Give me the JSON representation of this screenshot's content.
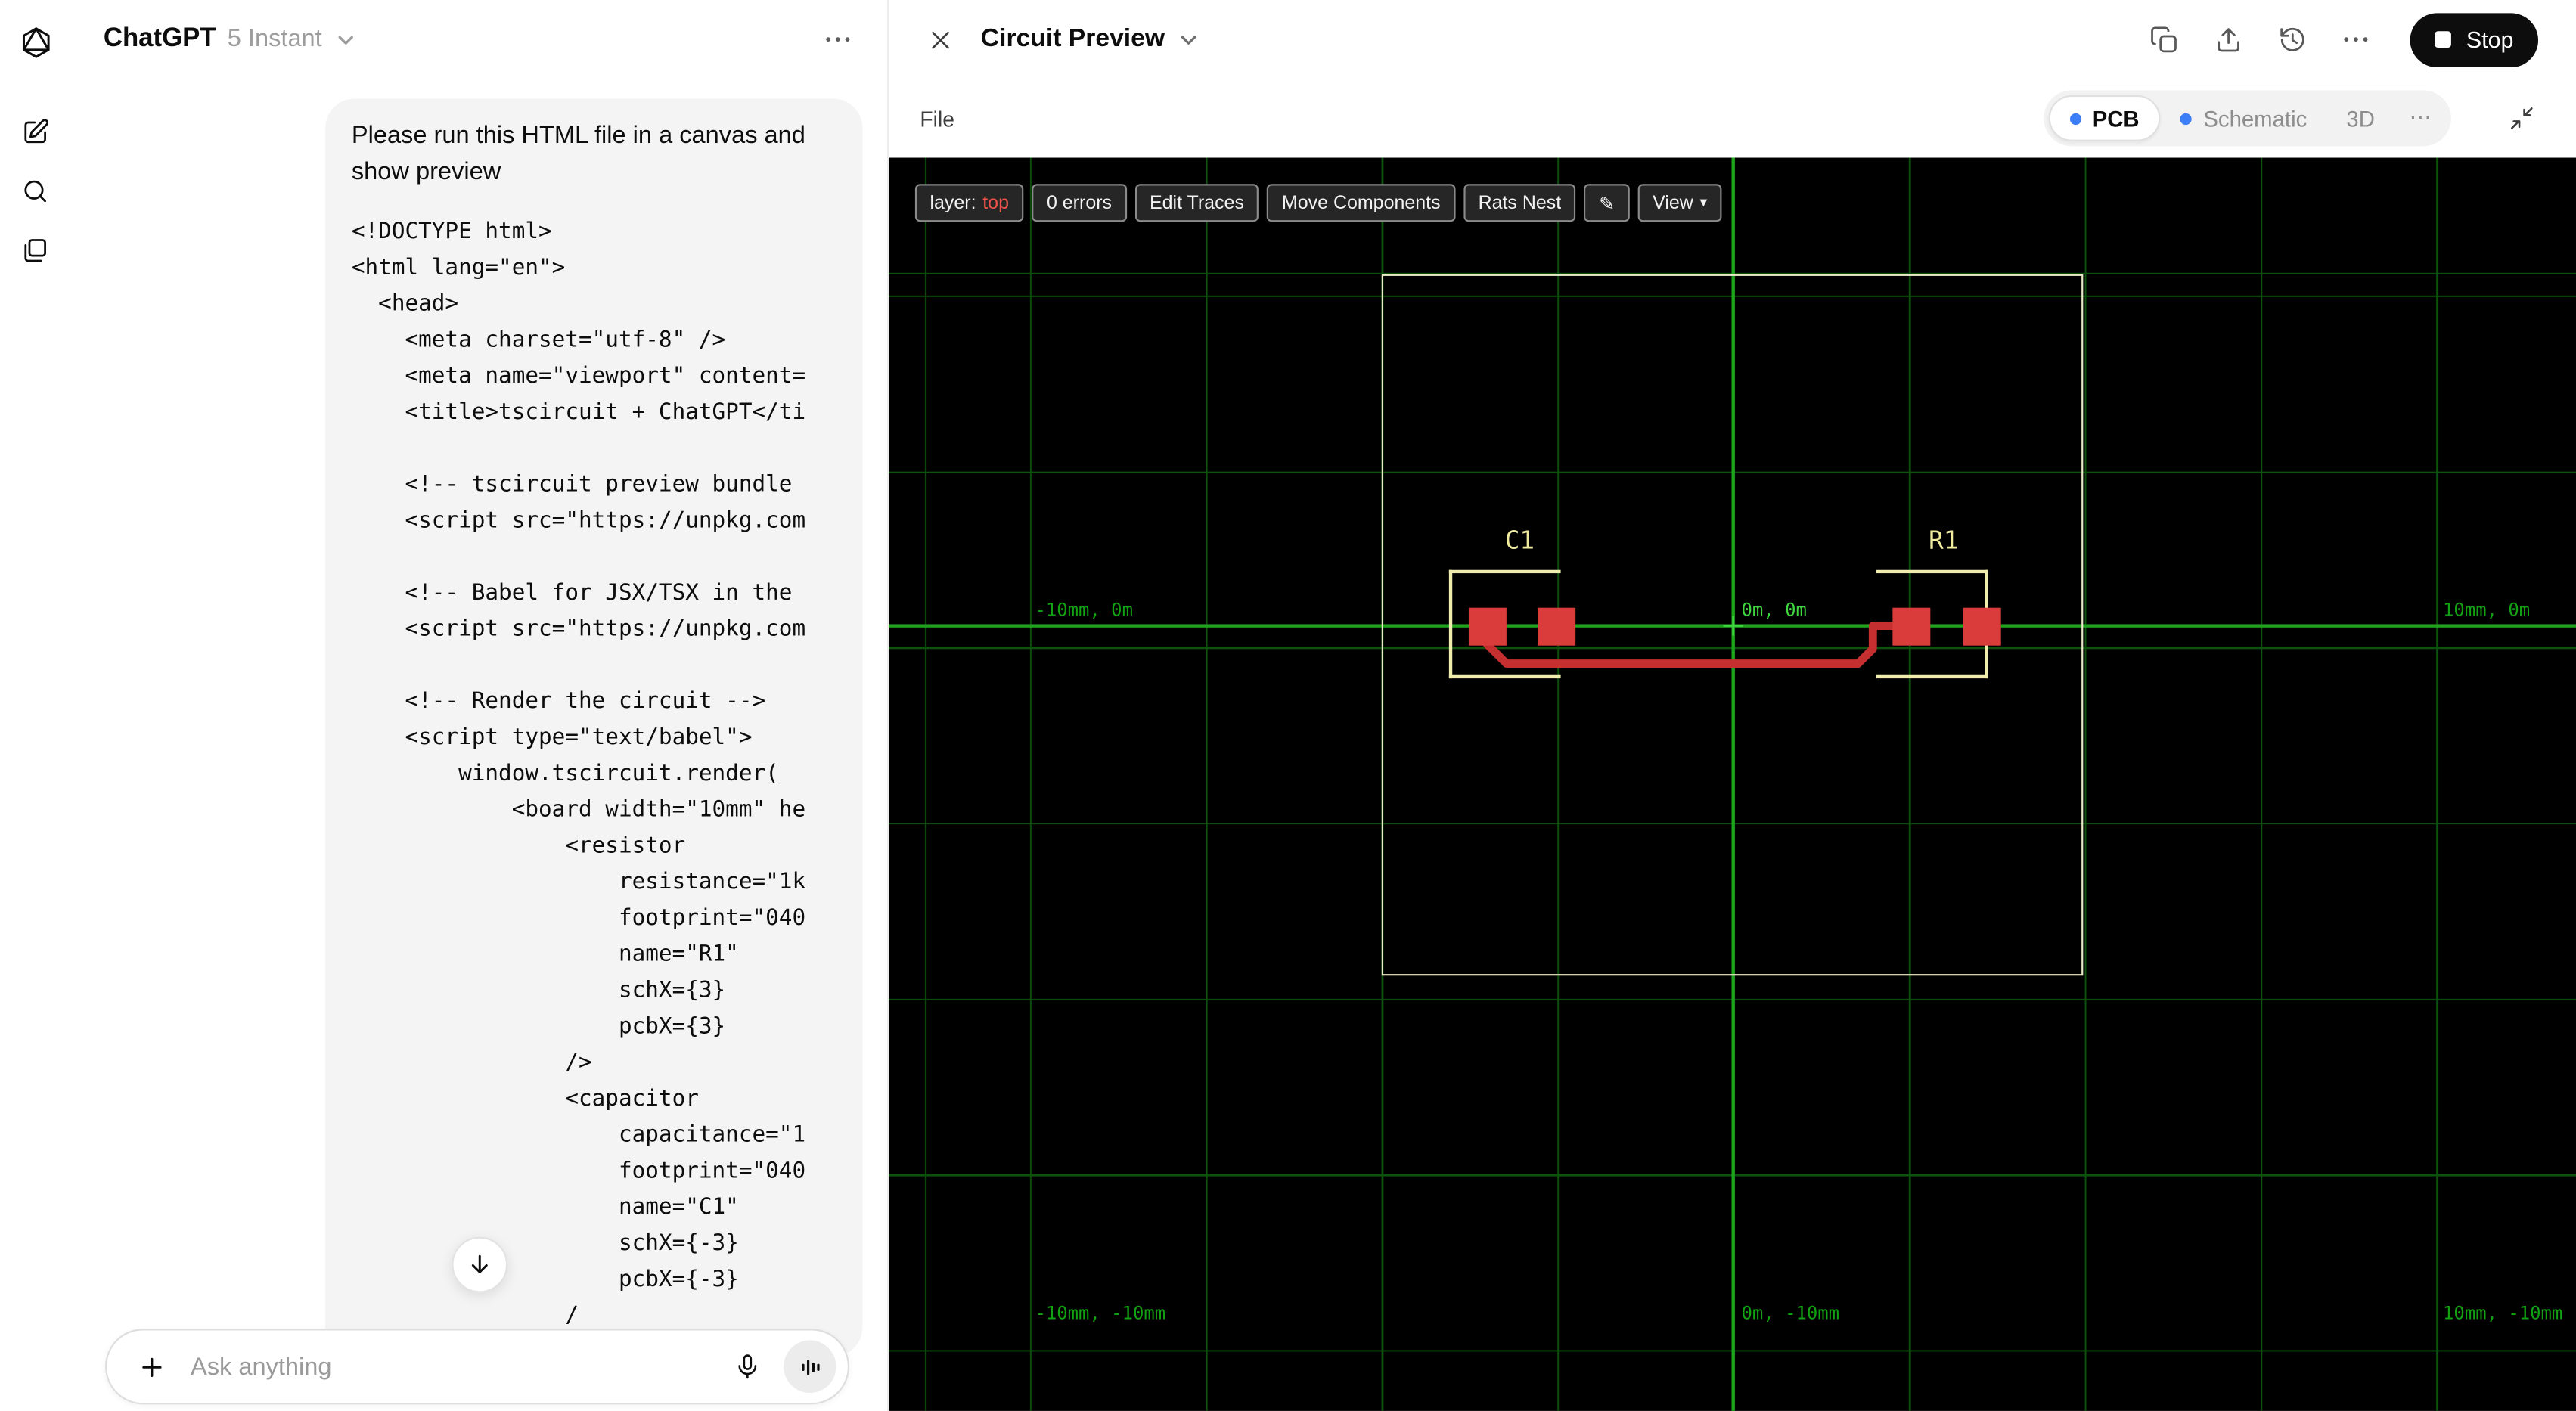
{
  "colors": {
    "accent_blue": "#3d7df5",
    "stop_button_bg": "#0d0d0d",
    "canvas_bg": "#000000",
    "grid_green": "#0d520d",
    "axis_green": "#1fa31f",
    "grid_label_green": "#12a112",
    "origin_label_green": "#3fd63f",
    "pad_red": "#da3b3b",
    "trace_red": "#c62f2f",
    "silkscreen_yellow": "#f0ecae",
    "board_outline_cream": "#ebe8c8",
    "layer_value_red": "#f0524a",
    "bubble_gray": "#f4f4f4"
  },
  "chat": {
    "header": {
      "title": "ChatGPT",
      "model": "5 Instant"
    },
    "message": {
      "intro": "Please run this HTML file in a canvas and show preview",
      "code_lines": [
        "<!DOCTYPE html>",
        "<html lang=\"en\">",
        "  <head>",
        "    <meta charset=\"utf-8\" />",
        "    <meta name=\"viewport\" content=",
        "    <title>tscircuit + ChatGPT</ti",
        "",
        "    <!-- tscircuit preview bundle",
        "    <script src=\"https://unpkg.com",
        "",
        "    <!-- Babel for JSX/TSX in the",
        "    <script src=\"https://unpkg.com",
        "",
        "    <!-- Render the circuit -->",
        "    <script type=\"text/babel\">",
        "        window.tscircuit.render(",
        "            <board width=\"10mm\" he",
        "                <resistor",
        "                    resistance=\"1k",
        "                    footprint=\"040",
        "                    name=\"R1\"",
        "                    schX={3}",
        "                    pcbX={3}",
        "                />",
        "                <capacitor",
        "                    capacitance=\"1",
        "                    footprint=\"040",
        "                    name=\"C1\"",
        "                    schX={-3}",
        "                    pcbX={-3}",
        "                /"
      ]
    },
    "composer": {
      "placeholder": "Ask anything"
    }
  },
  "preview": {
    "header": {
      "title": "Circuit Preview",
      "stop_label": "Stop"
    },
    "menubar": {
      "file": "File",
      "tabs": [
        {
          "label": "PCB",
          "active": true,
          "dot": true
        },
        {
          "label": "Schematic",
          "active": false,
          "dot": true
        },
        {
          "label": "3D",
          "active": false,
          "dot": false
        }
      ],
      "more": "⋯"
    },
    "canvas": {
      "toolbar": {
        "layer_label": "layer:",
        "layer_value": "top",
        "errors_label": "0 errors",
        "edit_traces": "Edit Traces",
        "move_components": "Move Components",
        "rats_nest": "Rats Nest",
        "pencil": "✎",
        "view_label": "View",
        "view_caret": "▾"
      },
      "grid_labels": {
        "mid_left": "-10mm, 0m",
        "mid_center": "0m, 0m",
        "mid_right": "10mm, 0m",
        "bottom_left": "-10mm, -10mm",
        "bottom_center": "0m, -10mm",
        "bottom_right": "10mm, -10mm"
      },
      "components": {
        "c1": "C1",
        "r1": "R1"
      }
    }
  }
}
